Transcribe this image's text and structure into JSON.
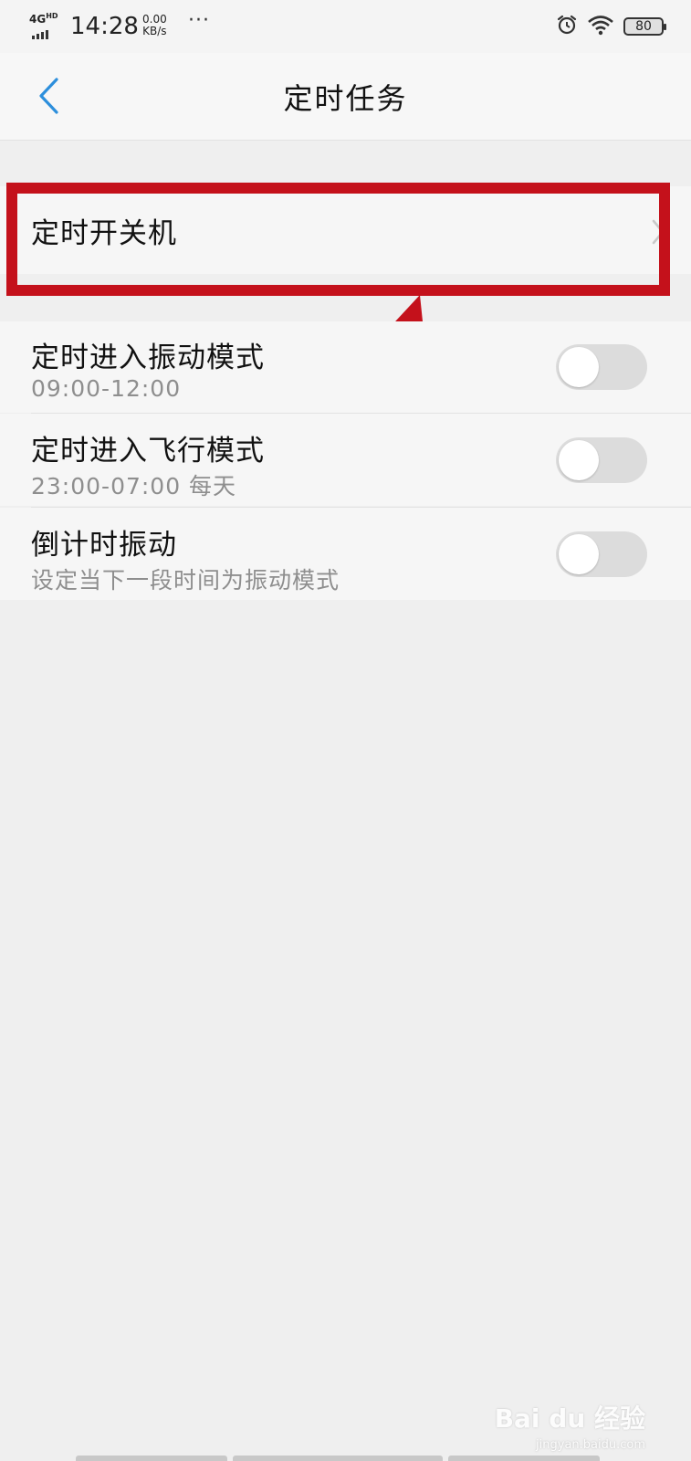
{
  "status_bar": {
    "network": "4G",
    "network_sup": "HD",
    "time": "14:28",
    "speed_value": "0.00",
    "speed_unit": "KB/s",
    "more": "···",
    "battery": "80",
    "icons": [
      "alarm-icon",
      "wifi-icon",
      "battery-icon"
    ]
  },
  "nav": {
    "title": "定时任务",
    "back_icon": "chevron-left-icon"
  },
  "scheduled_power": {
    "label": "定时开关机",
    "chevron_icon": "chevron-right-icon"
  },
  "toggles": [
    {
      "title": "定时进入振动模式",
      "subtitle": "09:00-12:00",
      "on": false
    },
    {
      "title": "定时进入飞行模式",
      "subtitle": "23:00-07:00 每天",
      "on": false
    },
    {
      "title": "倒计时振动",
      "subtitle": "设定当下一段时间为振动模式",
      "on": false
    }
  ],
  "annotation": {
    "highlight_color": "#c4111b"
  },
  "watermark": {
    "brand": "Bai du 经验",
    "url": "jingyan.baidu.com"
  },
  "colors": {
    "accent": "#2d8fdc",
    "background": "#efefef",
    "toggle_off": "#dcdcdc"
  }
}
